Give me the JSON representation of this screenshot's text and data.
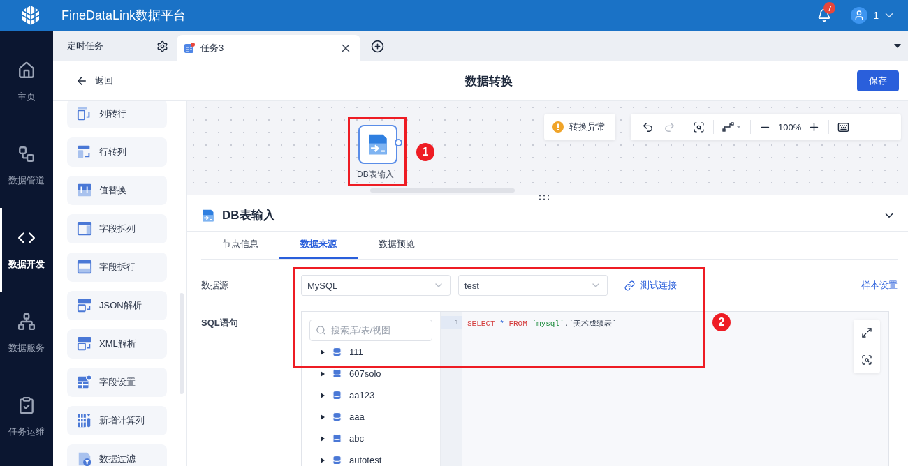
{
  "app": {
    "title": "FineDataLink数据平台",
    "notifications": "7",
    "user": "1"
  },
  "nav": [
    {
      "label": "主页",
      "kind": "home",
      "selected": false
    },
    {
      "label": "数据管道",
      "kind": "pipeline",
      "selected": false
    },
    {
      "label": "数据开发",
      "kind": "develop",
      "selected": true
    },
    {
      "label": "数据服务",
      "kind": "service",
      "selected": false
    },
    {
      "label": "任务运维",
      "kind": "ops",
      "selected": false
    }
  ],
  "tabs": [
    {
      "label": "定时任务",
      "kind": "settings",
      "selected": false
    },
    {
      "label": "任务3",
      "kind": "task",
      "selected": true
    }
  ],
  "header": {
    "back": "返回",
    "title": "数据转换",
    "save": "保存"
  },
  "operators": [
    {
      "label": "列转行",
      "kind": "col-row"
    },
    {
      "label": "行转列",
      "kind": "row-col"
    },
    {
      "label": "值替换",
      "kind": "replace"
    },
    {
      "label": "字段拆列",
      "kind": "split-col"
    },
    {
      "label": "字段拆行",
      "kind": "split-row"
    },
    {
      "label": "JSON解析",
      "kind": "json"
    },
    {
      "label": "XML解析",
      "kind": "xml"
    },
    {
      "label": "字段设置",
      "kind": "setting"
    },
    {
      "label": "新增计算列",
      "kind": "calc"
    },
    {
      "label": "数据过滤",
      "kind": "filter"
    }
  ],
  "canvas": {
    "node": {
      "label": "DB表输入"
    },
    "status": "转换异常",
    "zoom": "100%"
  },
  "annotations": [
    {
      "number": "1"
    },
    {
      "number": "2"
    }
  ],
  "panel": {
    "title": "DB表输入",
    "tabs": [
      {
        "label": "节点信息",
        "selected": false
      },
      {
        "label": "数据来源",
        "selected": true
      },
      {
        "label": "数据预览",
        "selected": false
      }
    ],
    "datasource_label": "数据源",
    "datasource": "MySQL",
    "database": "test",
    "test_link": "测试连接",
    "sample_link": "样本设置",
    "sql_label": "SQL语句",
    "search": {
      "placeholder": "搜索库/表/视图"
    },
    "tree": [
      {
        "label": "111",
        "expanded": false
      },
      {
        "label": "607solo",
        "expanded": false
      },
      {
        "label": "aa123",
        "expanded": false
      },
      {
        "label": "aaa",
        "expanded": false
      },
      {
        "label": "abc",
        "expanded": false
      },
      {
        "label": "autotest",
        "expanded": false
      }
    ],
    "code": {
      "line": "1",
      "tokens": [
        {
          "text": "SELECT ",
          "kind": "keyword"
        },
        {
          "text": "* ",
          "kind": "operator"
        },
        {
          "text": "FROM ",
          "kind": "keyword"
        },
        {
          "text": "`mysql`",
          "kind": "identifier"
        },
        {
          "text": ".`美术成绩表`",
          "kind": "text"
        }
      ]
    }
  }
}
